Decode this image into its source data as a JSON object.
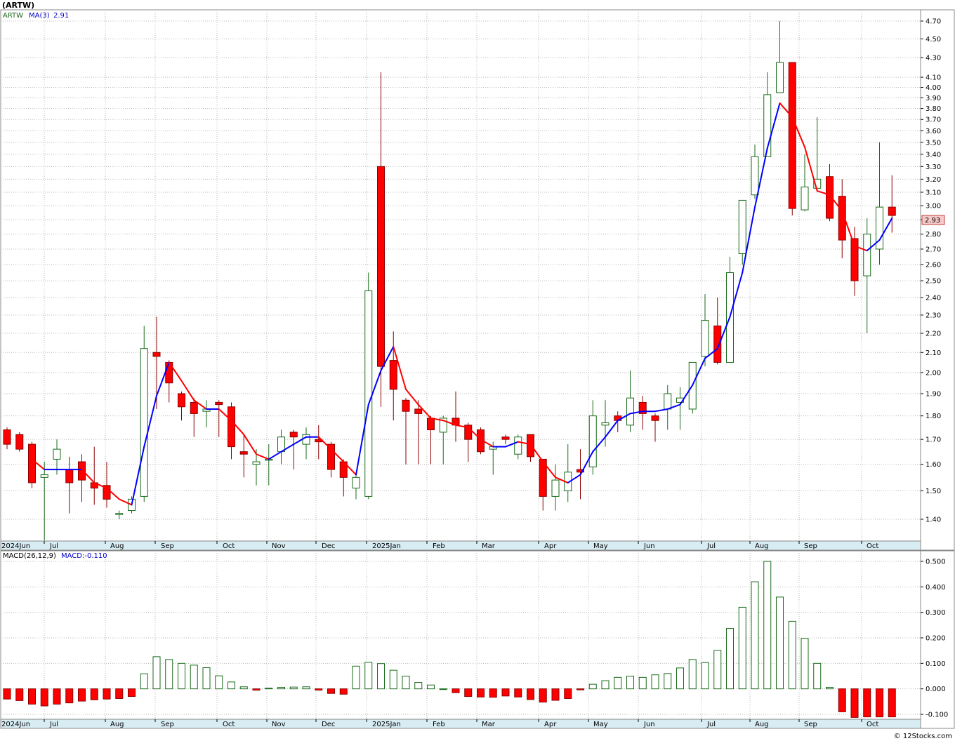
{
  "header": {
    "title": "(ARTW)"
  },
  "credit": "© 12Stocks.com",
  "colors": {
    "up_body": "#ffffff",
    "up_border": "#1a6b1a",
    "down_body": "#ff0000",
    "down_border": "#8b0000",
    "ma_up": "#0000ff",
    "ma_down": "#ff0000",
    "macd_pos": "#1a6b1a",
    "macd_neg": "#ff0000",
    "axis_bar": "#d8ecf4",
    "grid": "#bbbbbb"
  },
  "price_panel": {
    "ticker_label": "ARTW",
    "ma_label": "MA(3)",
    "ma_value": "2.91",
    "last_price_tag": "2.93",
    "y_ticks": [
      "1.40",
      "1.50",
      "1.60",
      "1.70",
      "1.80",
      "1.90",
      "2.00",
      "2.10",
      "2.20",
      "2.30",
      "2.40",
      "2.50",
      "2.60",
      "2.70",
      "2.80",
      "2.90",
      "3.00",
      "3.10",
      "3.20",
      "3.30",
      "3.40",
      "3.50",
      "3.60",
      "3.70",
      "3.80",
      "3.90",
      "4.00",
      "4.10",
      "4.30",
      "4.50",
      "4.70"
    ]
  },
  "macd_panel": {
    "label": "MACD(26,12,9)",
    "value_label": "MACD:-0.110",
    "y_ticks": [
      "0.500",
      "0.400",
      "0.300",
      "0.200",
      "0.100",
      "0.000",
      "-0.100"
    ]
  },
  "x_labels": [
    "2024Jun",
    "Jul",
    "Aug",
    "Sep",
    "Oct",
    "Nov",
    "Dec",
    "2025Jan",
    "Feb",
    "Mar",
    "Apr",
    "May",
    "Jun",
    "Jul",
    "Aug",
    "Sep",
    "Oct"
  ],
  "chart_data": {
    "type": "candlestick",
    "title": "(ARTW)",
    "scale": "log",
    "ylim": [
      1.33,
      4.75
    ],
    "interval": "weekly",
    "candles": [
      {
        "o": 1.74,
        "h": 1.75,
        "l": 1.66,
        "c": 1.68
      },
      {
        "o": 1.72,
        "h": 1.73,
        "l": 1.65,
        "c": 1.66
      },
      {
        "o": 1.68,
        "h": 1.69,
        "l": 1.51,
        "c": 1.53
      },
      {
        "o": 1.55,
        "h": 1.61,
        "l": 1.33,
        "c": 1.56
      },
      {
        "o": 1.62,
        "h": 1.7,
        "l": 1.56,
        "c": 1.66
      },
      {
        "o": 1.58,
        "h": 1.63,
        "l": 1.42,
        "c": 1.53
      },
      {
        "o": 1.61,
        "h": 1.64,
        "l": 1.46,
        "c": 1.54
      },
      {
        "o": 1.53,
        "h": 1.67,
        "l": 1.45,
        "c": 1.51
      },
      {
        "o": 1.52,
        "h": 1.61,
        "l": 1.44,
        "c": 1.47
      },
      {
        "o": 1.42,
        "h": 1.43,
        "l": 1.4,
        "c": 1.42
      },
      {
        "o": 1.43,
        "h": 1.48,
        "l": 1.42,
        "c": 1.47
      },
      {
        "o": 1.48,
        "h": 2.24,
        "l": 1.46,
        "c": 2.12
      },
      {
        "o": 2.1,
        "h": 2.29,
        "l": 1.83,
        "c": 2.08
      },
      {
        "o": 2.05,
        "h": 2.06,
        "l": 1.86,
        "c": 1.95
      },
      {
        "o": 1.9,
        "h": 1.91,
        "l": 1.78,
        "c": 1.84
      },
      {
        "o": 1.86,
        "h": 1.88,
        "l": 1.71,
        "c": 1.81
      },
      {
        "o": 1.82,
        "h": 1.87,
        "l": 1.75,
        "c": 1.83
      },
      {
        "o": 1.86,
        "h": 1.87,
        "l": 1.71,
        "c": 1.85
      },
      {
        "o": 1.84,
        "h": 1.86,
        "l": 1.62,
        "c": 1.67
      },
      {
        "o": 1.65,
        "h": 1.72,
        "l": 1.55,
        "c": 1.64
      },
      {
        "o": 1.6,
        "h": 1.66,
        "l": 1.52,
        "c": 1.61
      },
      {
        "o": 1.62,
        "h": 1.68,
        "l": 1.52,
        "c": 1.62
      },
      {
        "o": 1.65,
        "h": 1.74,
        "l": 1.6,
        "c": 1.71
      },
      {
        "o": 1.73,
        "h": 1.74,
        "l": 1.58,
        "c": 1.71
      },
      {
        "o": 1.68,
        "h": 1.75,
        "l": 1.62,
        "c": 1.72
      },
      {
        "o": 1.7,
        "h": 1.76,
        "l": 1.62,
        "c": 1.69
      },
      {
        "o": 1.68,
        "h": 1.69,
        "l": 1.55,
        "c": 1.58
      },
      {
        "o": 1.61,
        "h": 1.62,
        "l": 1.48,
        "c": 1.55
      },
      {
        "o": 1.51,
        "h": 1.57,
        "l": 1.47,
        "c": 1.55
      },
      {
        "o": 1.48,
        "h": 2.55,
        "l": 1.47,
        "c": 2.44
      },
      {
        "o": 3.3,
        "h": 4.15,
        "l": 1.84,
        "c": 2.03
      },
      {
        "o": 2.06,
        "h": 2.21,
        "l": 1.78,
        "c": 1.92
      },
      {
        "o": 1.87,
        "h": 1.88,
        "l": 1.6,
        "c": 1.82
      },
      {
        "o": 1.83,
        "h": 1.87,
        "l": 1.6,
        "c": 1.81
      },
      {
        "o": 1.79,
        "h": 1.8,
        "l": 1.6,
        "c": 1.74
      },
      {
        "o": 1.73,
        "h": 1.8,
        "l": 1.6,
        "c": 1.79
      },
      {
        "o": 1.79,
        "h": 1.91,
        "l": 1.69,
        "c": 1.76
      },
      {
        "o": 1.76,
        "h": 1.77,
        "l": 1.61,
        "c": 1.7
      },
      {
        "o": 1.74,
        "h": 1.75,
        "l": 1.64,
        "c": 1.65
      },
      {
        "o": 1.66,
        "h": 1.69,
        "l": 1.56,
        "c": 1.67
      },
      {
        "o": 1.71,
        "h": 1.72,
        "l": 1.68,
        "c": 1.7
      },
      {
        "o": 1.64,
        "h": 1.72,
        "l": 1.62,
        "c": 1.71
      },
      {
        "o": 1.72,
        "h": 1.72,
        "l": 1.61,
        "c": 1.63
      },
      {
        "o": 1.62,
        "h": 1.62,
        "l": 1.43,
        "c": 1.48
      },
      {
        "o": 1.48,
        "h": 1.6,
        "l": 1.43,
        "c": 1.54
      },
      {
        "o": 1.5,
        "h": 1.68,
        "l": 1.46,
        "c": 1.57
      },
      {
        "o": 1.58,
        "h": 1.66,
        "l": 1.47,
        "c": 1.57
      },
      {
        "o": 1.59,
        "h": 1.87,
        "l": 1.56,
        "c": 1.8
      },
      {
        "o": 1.76,
        "h": 1.87,
        "l": 1.67,
        "c": 1.77
      },
      {
        "o": 1.8,
        "h": 1.82,
        "l": 1.73,
        "c": 1.78
      },
      {
        "o": 1.76,
        "h": 2.01,
        "l": 1.73,
        "c": 1.88
      },
      {
        "o": 1.86,
        "h": 1.89,
        "l": 1.74,
        "c": 1.81
      },
      {
        "o": 1.8,
        "h": 1.81,
        "l": 1.69,
        "c": 1.78
      },
      {
        "o": 1.83,
        "h": 1.94,
        "l": 1.74,
        "c": 1.9
      },
      {
        "o": 1.86,
        "h": 1.93,
        "l": 1.74,
        "c": 1.88
      },
      {
        "o": 1.83,
        "h": 2.05,
        "l": 1.81,
        "c": 2.05
      },
      {
        "o": 2.08,
        "h": 2.42,
        "l": 2.03,
        "c": 2.27
      },
      {
        "o": 2.24,
        "h": 2.4,
        "l": 2.04,
        "c": 2.05
      },
      {
        "o": 2.05,
        "h": 2.65,
        "l": 2.05,
        "c": 2.55
      },
      {
        "o": 2.67,
        "h": 3.04,
        "l": 2.6,
        "c": 3.04
      },
      {
        "o": 3.08,
        "h": 3.48,
        "l": 3.05,
        "c": 3.38
      },
      {
        "o": 3.38,
        "h": 4.15,
        "l": 3.38,
        "c": 3.93
      },
      {
        "o": 3.95,
        "h": 4.7,
        "l": 3.95,
        "c": 4.25
      },
      {
        "o": 4.25,
        "h": 4.25,
        "l": 2.93,
        "c": 2.98
      },
      {
        "o": 2.97,
        "h": 3.4,
        "l": 2.96,
        "c": 3.14
      },
      {
        "o": 3.13,
        "h": 3.72,
        "l": 3.13,
        "c": 3.2
      },
      {
        "o": 3.22,
        "h": 3.32,
        "l": 2.89,
        "c": 2.91
      },
      {
        "o": 3.07,
        "h": 3.2,
        "l": 2.64,
        "c": 2.76
      },
      {
        "o": 2.77,
        "h": 2.85,
        "l": 2.41,
        "c": 2.5
      },
      {
        "o": 2.53,
        "h": 2.91,
        "l": 2.2,
        "c": 2.8
      },
      {
        "o": 2.7,
        "h": 3.5,
        "l": 2.6,
        "c": 2.99
      },
      {
        "o": 2.99,
        "h": 3.23,
        "l": 2.81,
        "c": 2.93
      }
    ],
    "ma3": [
      null,
      null,
      1.62,
      1.58,
      1.58,
      1.58,
      1.58,
      1.53,
      1.51,
      1.47,
      1.45,
      1.67,
      1.89,
      2.05,
      1.96,
      1.87,
      1.83,
      1.83,
      1.78,
      1.72,
      1.64,
      1.62,
      1.65,
      1.68,
      1.71,
      1.71,
      1.66,
      1.61,
      1.56,
      1.85,
      2.01,
      2.13,
      1.92,
      1.85,
      1.79,
      1.78,
      1.76,
      1.75,
      1.7,
      1.67,
      1.67,
      1.69,
      1.68,
      1.61,
      1.55,
      1.53,
      1.56,
      1.65,
      1.71,
      1.78,
      1.81,
      1.82,
      1.82,
      1.83,
      1.85,
      1.94,
      2.07,
      2.12,
      2.29,
      2.55,
      2.99,
      3.45,
      3.85,
      3.72,
      3.46,
      3.11,
      3.08,
      2.96,
      2.72,
      2.69,
      2.76,
      2.91
    ],
    "macd": [
      -0.04,
      -0.046,
      -0.06,
      -0.067,
      -0.06,
      -0.055,
      -0.048,
      -0.043,
      -0.04,
      -0.038,
      -0.03,
      0.059,
      0.126,
      0.115,
      0.1,
      0.093,
      0.083,
      0.051,
      0.027,
      0.008,
      -0.005,
      0.003,
      0.006,
      0.007,
      0.008,
      -0.005,
      -0.018,
      -0.021,
      0.089,
      0.104,
      0.099,
      0.073,
      0.05,
      0.025,
      0.015,
      0,
      -0.015,
      -0.03,
      -0.032,
      -0.033,
      -0.028,
      -0.032,
      -0.042,
      -0.052,
      -0.045,
      -0.038,
      -0.004,
      0.018,
      0.032,
      0.045,
      0.05,
      0.045,
      0.055,
      0.06,
      0.082,
      0.115,
      0.103,
      0.151,
      0.237,
      0.32,
      0.42,
      0.5,
      0.36,
      0.265,
      0.198,
      0.1,
      0.006,
      -0.09,
      -0.112,
      -0.11,
      -0.11,
      -0.11
    ]
  }
}
